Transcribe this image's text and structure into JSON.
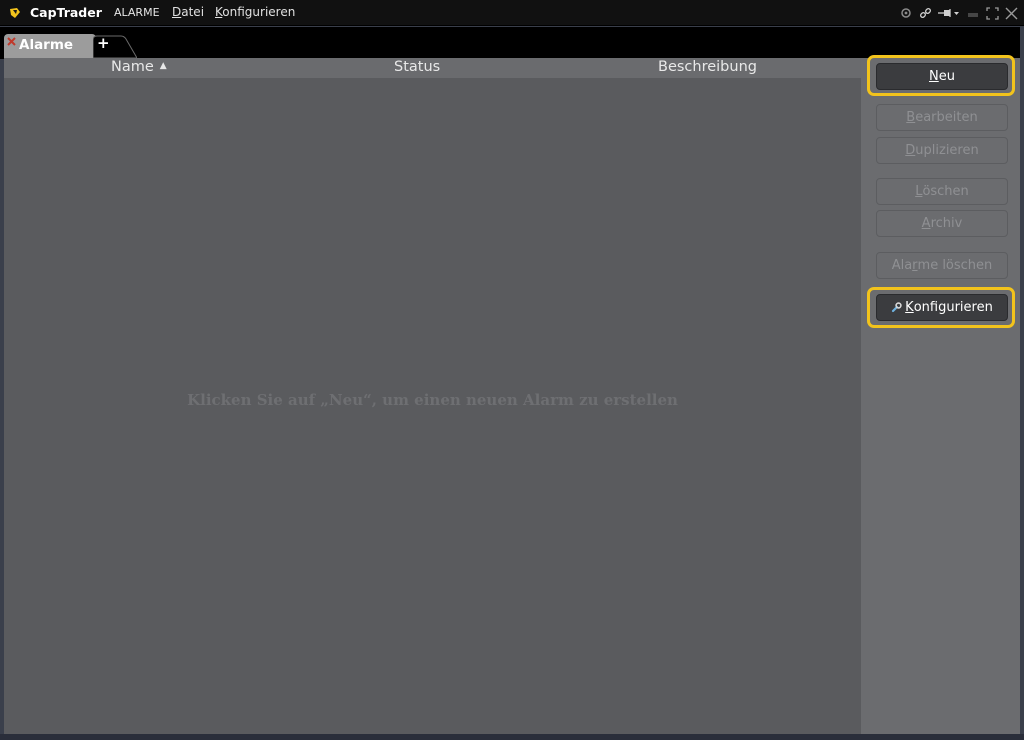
{
  "titlebar": {
    "app_name": "CapTrader",
    "window_name": "ALARME",
    "menu": [
      {
        "label": "Datei",
        "mnemonic": "D",
        "rest": "atei"
      },
      {
        "label": "Konfigurieren",
        "mnemonic": "K",
        "rest": "onfigurieren"
      }
    ],
    "icons": [
      "settings-icon",
      "link-icon",
      "pin-icon",
      "minimize-icon",
      "maximize-icon",
      "close-icon"
    ]
  },
  "tabs": [
    {
      "label": "Alarme",
      "active": true,
      "close_icon": "close-x-icon"
    },
    {
      "label": "+",
      "type": "add-tab"
    }
  ],
  "table": {
    "columns": [
      {
        "label": "Name",
        "sorted": "ascending"
      },
      {
        "label": "Status"
      },
      {
        "label": "Beschreibung"
      }
    ],
    "rows": [],
    "empty_message": "Klicken Sie auf „Neu“, um einen neuen Alarm zu erstellen"
  },
  "side_panel": {
    "buttons": [
      {
        "label": "Neu",
        "mnemonic": "N",
        "rest": "eu",
        "state": "enabled",
        "highlighted": true
      },
      {
        "label": "Bearbeiten",
        "mnemonic": "B",
        "rest": "earbeiten",
        "state": "disabled"
      },
      {
        "label": "Duplizieren",
        "mnemonic": "D",
        "rest": "uplizieren",
        "state": "disabled"
      },
      {
        "label": "Löschen",
        "mnemonic": "L",
        "rest": "öschen",
        "state": "disabled"
      },
      {
        "label": "Archiv",
        "mnemonic": "A",
        "rest": "rchiv",
        "state": "disabled"
      },
      {
        "label": "Alarme löschen",
        "pre": "Ala",
        "mnemonic": "r",
        "rest": "me löschen",
        "state": "disabled"
      },
      {
        "label": "Konfigurieren",
        "mnemonic": "K",
        "rest": "onfigurieren",
        "state": "enabled",
        "highlighted": true,
        "icon": "wrench-icon"
      }
    ]
  },
  "colors": {
    "highlight": "#f2c31c",
    "titlebar_bg": "#111111",
    "content_bg": "#5a5b5e",
    "side_bg": "#6b6c6f",
    "active_button_bg": "#3b3c3f"
  }
}
